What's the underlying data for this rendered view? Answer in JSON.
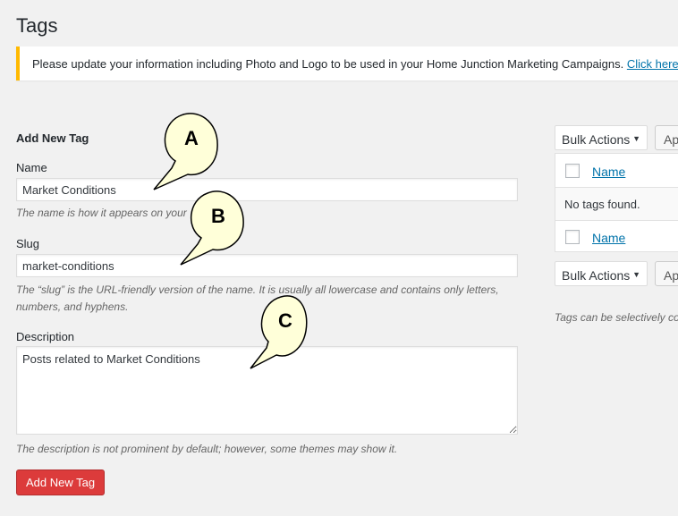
{
  "page": {
    "title": "Tags"
  },
  "notice": {
    "text": "Please update your information including Photo and Logo to be used in your Home Junction Marketing Campaigns. ",
    "link": "Click here"
  },
  "form": {
    "heading": "Add New Tag",
    "name": {
      "label": "Name",
      "value": "Market Conditions",
      "hint": "The name is how it appears on your"
    },
    "slug": {
      "label": "Slug",
      "value": "market-conditions",
      "hint": "The “slug” is the URL-friendly version of the name. It is usually all lowercase and contains only letters, numbers, and hyphens."
    },
    "description": {
      "label": "Description",
      "value": "Posts related to Market Conditions",
      "hint": "The description is not prominent by default; however, some themes may show it."
    },
    "submit_label": "Add New Tag"
  },
  "list": {
    "bulk_actions_label": "Bulk Actions",
    "apply_label": "Ap",
    "column_name": "Name",
    "empty_text": "No tags found.",
    "side_hint": "Tags can be selectively co"
  },
  "callouts": {
    "a": "A",
    "b": "B",
    "c": "C"
  },
  "colors": {
    "notice_border": "#ffb900",
    "primary_button": "#dc3b3b",
    "link": "#0073aa",
    "callout_fill": "#ffffd9"
  }
}
